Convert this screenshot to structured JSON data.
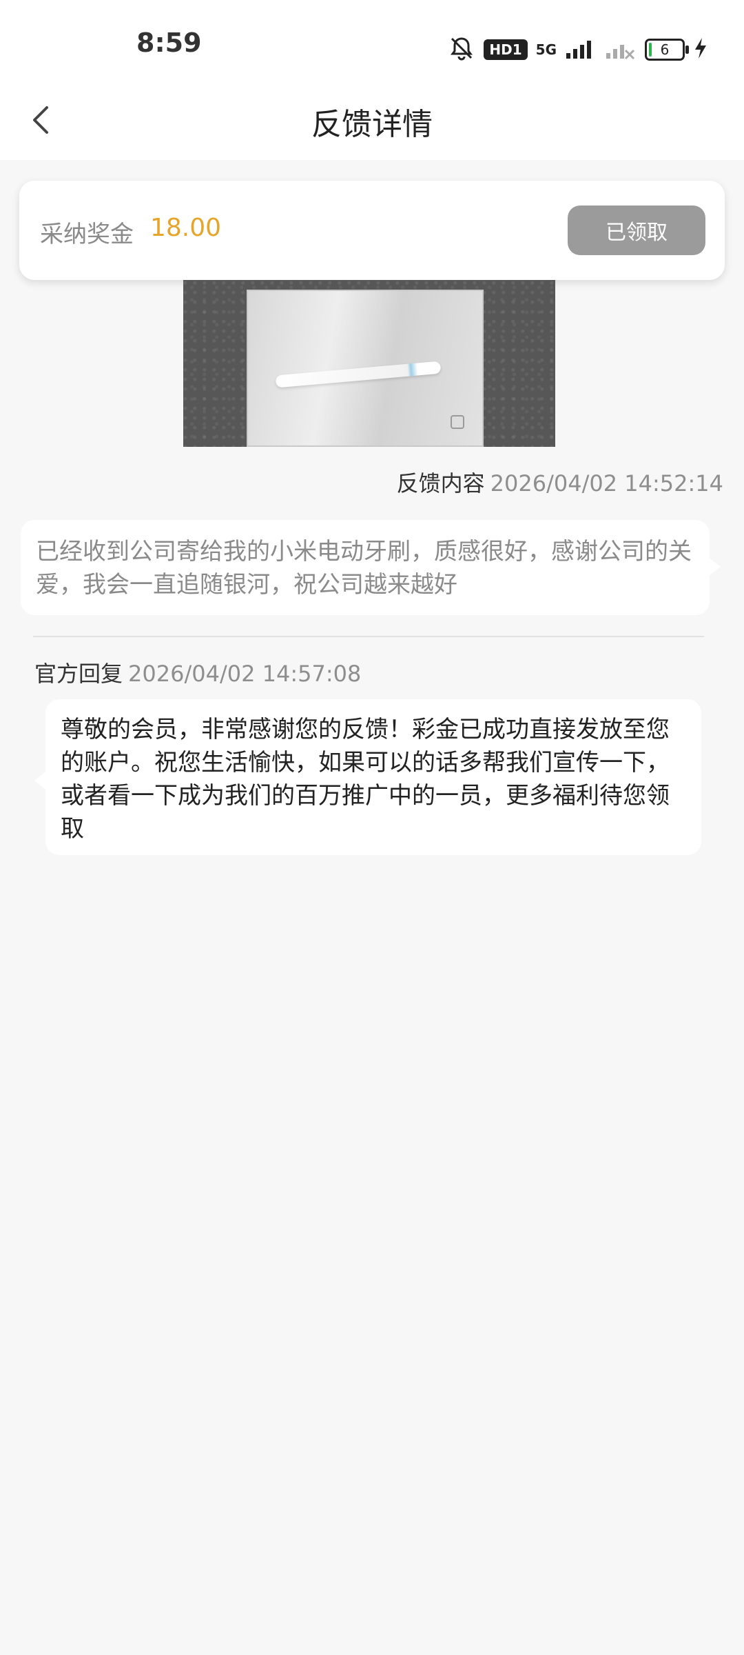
{
  "status_bar": {
    "time": "8:59",
    "hd_label": "HD1",
    "network_label": "5G",
    "battery_level": "6"
  },
  "nav": {
    "title": "反馈详情"
  },
  "reward": {
    "label": "采纳奖金",
    "amount": "18.00",
    "button_label": "已领取"
  },
  "feedback": {
    "label": "反馈内容",
    "time": "2026/04/02 14:52:14",
    "content": "已经收到公司寄给我的小米电动牙刷，质感很好，感谢公司的关爱，我会一直追随银河，祝公司越来越好"
  },
  "reply": {
    "label": "官方回复",
    "time": "2026/04/02 14:57:08",
    "content": "尊敬的会员，非常感谢您的反馈！彩金已成功直接发放至您的账户。祝您生活愉快，如果可以的话多帮我们宣传一下，或者看一下成为我们的百万推广中的一员，更多福利待您领取"
  },
  "colors": {
    "accent_amount": "#e6a52a",
    "claimed_button": "#9b9b9b",
    "background": "#f7f7f7"
  },
  "icons": {
    "back": "chevron-left-icon",
    "mute": "bell-off-icon",
    "signal": "signal-icon",
    "charging": "bolt-icon"
  }
}
